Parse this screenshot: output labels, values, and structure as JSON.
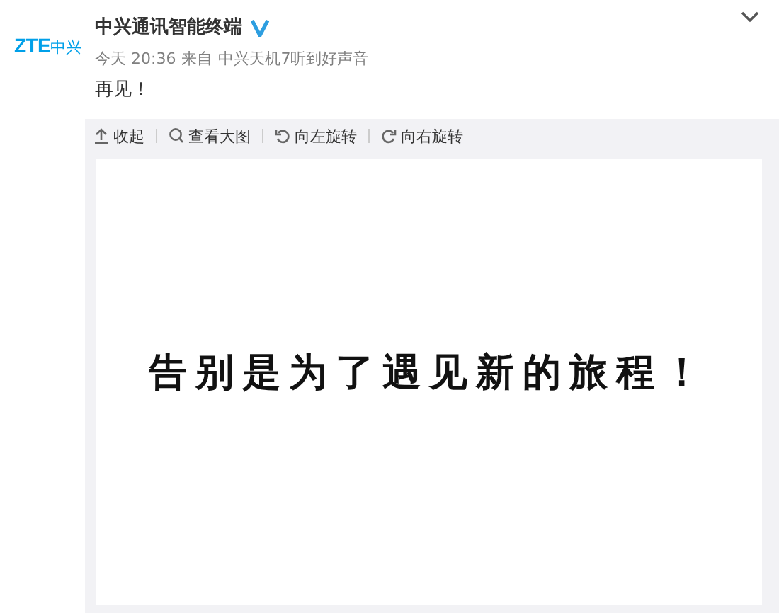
{
  "avatar": {
    "logo_latin": "ZTE",
    "logo_cjk": "中兴"
  },
  "author": {
    "name": "中兴通讯智能终端",
    "verified": true
  },
  "meta": {
    "time": "今天 20:36",
    "source_prefix": "来自",
    "source": "中兴天机7听到好声音"
  },
  "text": "再见！",
  "toolbar": [
    {
      "kind": "collapse",
      "label": "收起"
    },
    {
      "kind": "zoom",
      "label": "查看大图"
    },
    {
      "kind": "rotate-left",
      "label": "向左旋转"
    },
    {
      "kind": "rotate-right",
      "label": "向右旋转"
    }
  ],
  "image": {
    "caption": "告别是为了遇见新的旅程！"
  }
}
